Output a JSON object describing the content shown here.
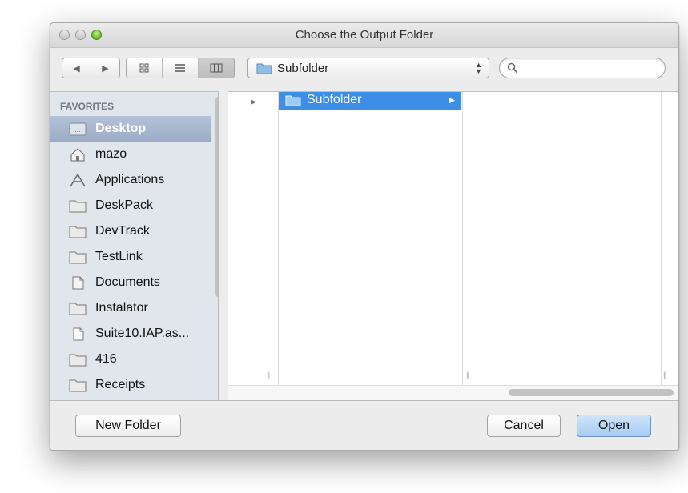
{
  "window": {
    "title": "Choose the Output Folder"
  },
  "toolbar": {
    "back_icon": "back-arrow-icon",
    "forward_icon": "forward-arrow-icon",
    "view_modes": [
      "icon-view",
      "list-view",
      "column-view"
    ],
    "active_view": "column-view",
    "path_popup_value": "Subfolder",
    "search_placeholder": ""
  },
  "sidebar": {
    "heading": "FAVORITES",
    "items": [
      {
        "label": "Desktop",
        "icon": "desktop-icon",
        "selected": true
      },
      {
        "label": "mazo",
        "icon": "home-icon"
      },
      {
        "label": "Applications",
        "icon": "applications-icon"
      },
      {
        "label": "DeskPack",
        "icon": "folder-icon"
      },
      {
        "label": "DevTrack",
        "icon": "folder-icon"
      },
      {
        "label": "TestLink",
        "icon": "folder-icon"
      },
      {
        "label": "Documents",
        "icon": "documents-icon"
      },
      {
        "label": "Instalator",
        "icon": "folder-icon"
      },
      {
        "label": "Suite10.IAP.as...",
        "icon": "file-icon"
      },
      {
        "label": "416",
        "icon": "folder-icon"
      },
      {
        "label": "Receipts",
        "icon": "folder-icon"
      }
    ]
  },
  "browser": {
    "column1": [
      {
        "label": "Subfolder",
        "selected": true
      }
    ]
  },
  "buttons": {
    "new_folder": "New Folder",
    "cancel": "Cancel",
    "open": "Open"
  },
  "colors": {
    "selection_blue": "#3d8ee6",
    "sidebar_bg": "#e1e6ec",
    "default_button": "#a7cbf2"
  }
}
